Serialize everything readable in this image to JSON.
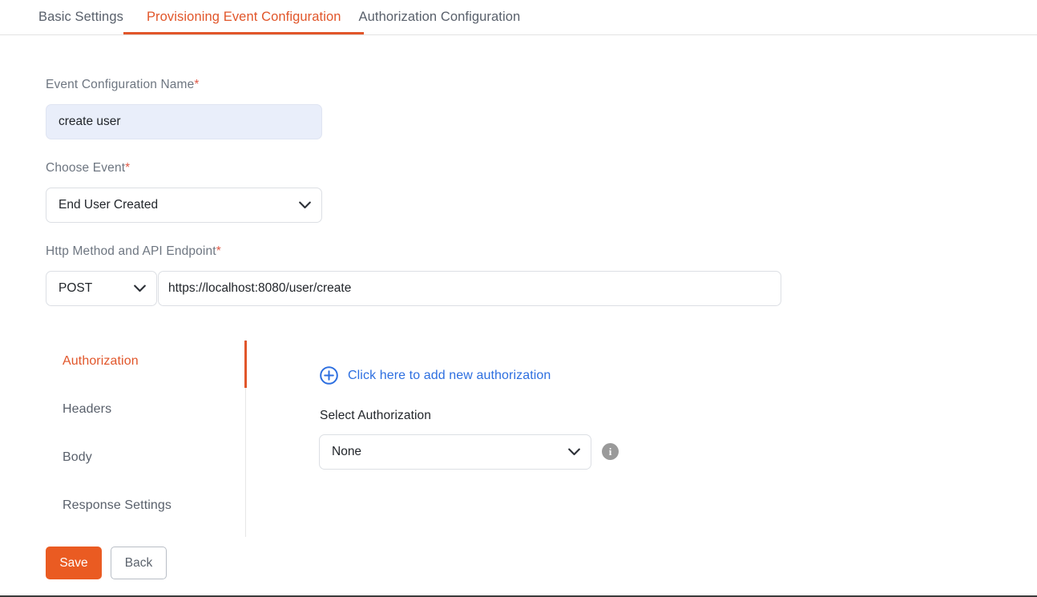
{
  "tabs": [
    {
      "label": "Basic Settings",
      "active": false
    },
    {
      "label": "Provisioning Event Configuration",
      "active": true
    },
    {
      "label": "Authorization Configuration",
      "active": false
    }
  ],
  "form": {
    "event_config_name": {
      "label": "Event Configuration Name",
      "required_mark": "*",
      "value": "create user"
    },
    "choose_event": {
      "label": "Choose Event",
      "required_mark": "*",
      "value": "End User Created"
    },
    "http_method_endpoint": {
      "label": "Http Method and API Endpoint",
      "required_mark": "*",
      "method": "POST",
      "url": "https://localhost:8080/user/create"
    }
  },
  "side_nav": [
    {
      "label": "Authorization",
      "active": true
    },
    {
      "label": "Headers",
      "active": false
    },
    {
      "label": "Body",
      "active": false
    },
    {
      "label": "Response Settings",
      "active": false
    }
  ],
  "auth_panel": {
    "add_link": "Click here to add new authorization",
    "select_label": "Select Authorization",
    "select_value": "None",
    "info_glyph": "i"
  },
  "footer": {
    "save_label": "Save",
    "back_label": "Back"
  },
  "colors": {
    "accent_orange": "#e1562a",
    "save_orange": "#ea5b22",
    "link_blue": "#2d6fe0",
    "label_gray": "#6e7681",
    "required_red": "#e05a47",
    "focus_field_bg": "#e9eefa",
    "info_gray": "#9a9a9a"
  }
}
